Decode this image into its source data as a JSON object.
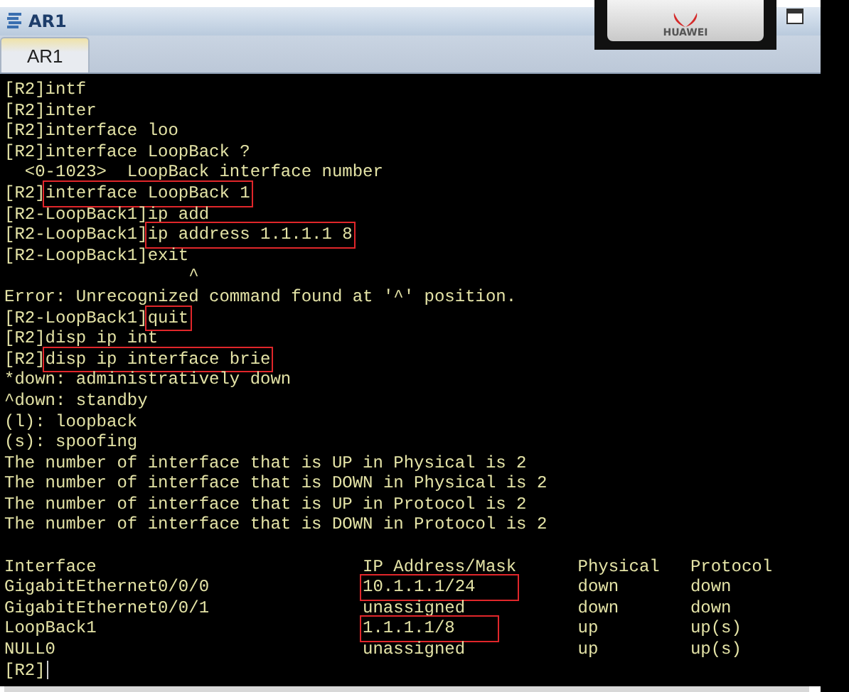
{
  "window": {
    "title": "AR1",
    "badge": "HUAWEI"
  },
  "tabs": [
    {
      "label": "AR1",
      "selected": true
    }
  ],
  "terminal": {
    "lines": [
      {
        "segments": [
          {
            "text": "[R2]intf",
            "boxed": false
          }
        ]
      },
      {
        "segments": [
          {
            "text": "[R2]inter",
            "boxed": false
          }
        ]
      },
      {
        "segments": [
          {
            "text": "[R2]interface loo",
            "boxed": false
          }
        ]
      },
      {
        "segments": [
          {
            "text": "[R2]interface LoopBack ?",
            "boxed": false
          }
        ]
      },
      {
        "segments": [
          {
            "text": "  <0-1023>  LoopBack interface number",
            "boxed": false
          }
        ]
      },
      {
        "segments": [
          {
            "text": "[R2]",
            "boxed": false
          },
          {
            "text": "interface LoopBack 1",
            "boxed": true
          }
        ]
      },
      {
        "segments": [
          {
            "text": "[R2-LoopBack1]ip add",
            "boxed": false
          }
        ]
      },
      {
        "segments": [
          {
            "text": "[R2-LoopBack1]",
            "boxed": false
          },
          {
            "text": "ip address 1.1.1.1 8",
            "boxed": true
          }
        ]
      },
      {
        "segments": [
          {
            "text": "[R2-LoopBack1]exit",
            "boxed": false
          }
        ]
      },
      {
        "segments": [
          {
            "text": "                  ^",
            "boxed": false
          }
        ]
      },
      {
        "segments": [
          {
            "text": "Error: Unrecognized command found at '^' position.",
            "boxed": false
          }
        ]
      },
      {
        "segments": [
          {
            "text": "[R2-LoopBack1]",
            "boxed": false
          },
          {
            "text": "quit",
            "boxed": true
          }
        ]
      },
      {
        "segments": [
          {
            "text": "[R2]disp ip int",
            "boxed": false
          }
        ]
      },
      {
        "segments": [
          {
            "text": "[R2]",
            "boxed": false
          },
          {
            "text": "disp ip interface brie",
            "boxed": true
          }
        ]
      },
      {
        "segments": [
          {
            "text": "*down: administratively down",
            "boxed": false
          }
        ]
      },
      {
        "segments": [
          {
            "text": "^down: standby",
            "boxed": false
          }
        ]
      },
      {
        "segments": [
          {
            "text": "(l): loopback",
            "boxed": false
          }
        ]
      },
      {
        "segments": [
          {
            "text": "(s): spoofing",
            "boxed": false
          }
        ]
      },
      {
        "segments": [
          {
            "text": "The number of interface that is UP in Physical is 2",
            "boxed": false
          }
        ]
      },
      {
        "segments": [
          {
            "text": "The number of interface that is DOWN in Physical is 2",
            "boxed": false
          }
        ]
      },
      {
        "segments": [
          {
            "text": "The number of interface that is UP in Protocol is 2",
            "boxed": false
          }
        ]
      },
      {
        "segments": [
          {
            "text": "The number of interface that is DOWN in Protocol is 2",
            "boxed": false
          }
        ]
      }
    ],
    "table": {
      "columns": [
        "Interface",
        "IP Address/Mask",
        "Physical",
        "Protocol"
      ],
      "rows": [
        {
          "cells": [
            {
              "text": "GigabitEthernet0/0/0",
              "boxed": false
            },
            {
              "text": "10.1.1.1/24",
              "boxed": true
            },
            {
              "text": "down",
              "boxed": false
            },
            {
              "text": "down",
              "boxed": false
            }
          ]
        },
        {
          "cells": [
            {
              "text": "GigabitEthernet0/0/1",
              "boxed": false
            },
            {
              "text": "unassigned",
              "boxed": false
            },
            {
              "text": "down",
              "boxed": false
            },
            {
              "text": "down",
              "boxed": false
            }
          ]
        },
        {
          "cells": [
            {
              "text": "LoopBack1",
              "boxed": false
            },
            {
              "text": "1.1.1.1/8",
              "boxed": true
            },
            {
              "text": "up",
              "boxed": false
            },
            {
              "text": "up(s)",
              "boxed": false
            }
          ]
        },
        {
          "cells": [
            {
              "text": "NULL0",
              "boxed": false
            },
            {
              "text": "unassigned",
              "boxed": false
            },
            {
              "text": "up",
              "boxed": false
            },
            {
              "text": "up(s)",
              "boxed": false
            }
          ]
        }
      ]
    },
    "prompt": "[R2]"
  }
}
